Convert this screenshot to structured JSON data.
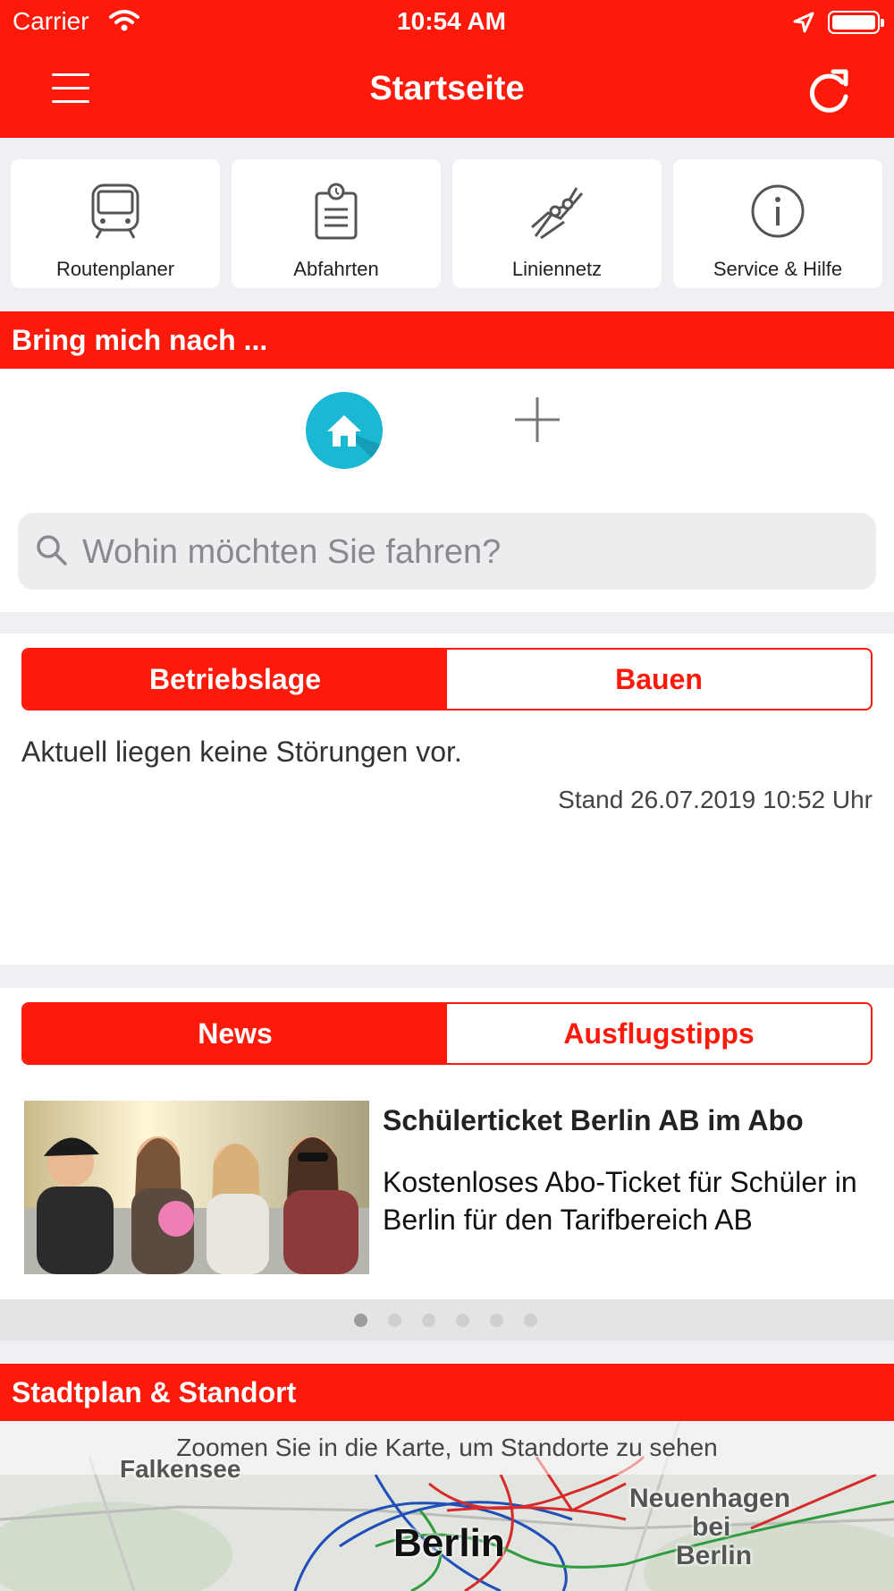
{
  "status_bar": {
    "carrier": "Carrier",
    "time": "10:54 AM"
  },
  "nav": {
    "title": "Startseite"
  },
  "tiles": [
    {
      "label": "Routenplaner",
      "icon": "train-icon"
    },
    {
      "label": "Abfahrten",
      "icon": "clipboard-clock-icon"
    },
    {
      "label": "Liniennetz",
      "icon": "line-network-icon"
    },
    {
      "label": "Service & Hilfe",
      "icon": "info-icon"
    }
  ],
  "bring": {
    "title": "Bring mich nach ...",
    "search_placeholder": "Wohin möchten Sie fahren?"
  },
  "status_tabs": {
    "left": "Betriebslage",
    "right": "Bauen",
    "active": "left"
  },
  "status": {
    "message": "Aktuell liegen keine Störungen vor.",
    "stand": "Stand 26.07.2019 10:52 Uhr"
  },
  "news_tabs": {
    "left": "News",
    "right": "Ausflugstipps",
    "active": "left"
  },
  "news": {
    "headline": "Schülerticket Berlin AB im Abo",
    "description": "Kostenloses Abo-Ticket für Schüler in Berlin für den Tarifbereich AB",
    "pages": 6,
    "current_page": 1
  },
  "map": {
    "title": "Stadtplan & Standort",
    "hint": "Zoomen Sie in die Karte, um Standorte zu sehen",
    "labels": {
      "falkensee": "Falkensee",
      "berlin": "Berlin",
      "neuenhagen_1": "Neuenhagen",
      "neuenhagen_2": "bei",
      "neuenhagen_3": "Berlin"
    }
  },
  "colors": {
    "brand_red": "#fe1a0a",
    "home_teal": "#1ab8d3"
  }
}
